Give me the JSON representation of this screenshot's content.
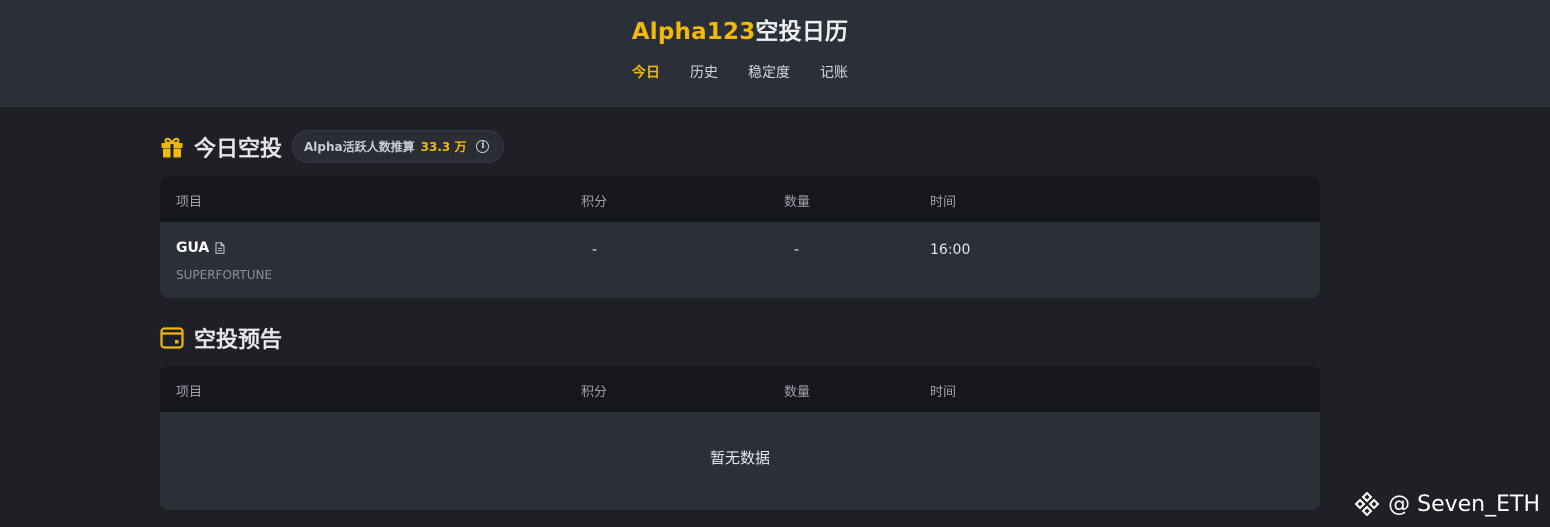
{
  "header": {
    "title_accent": "Alpha123",
    "title_rest": "空投日历",
    "nav": [
      {
        "label": "今日",
        "active": true
      },
      {
        "label": "历史",
        "active": false
      },
      {
        "label": "稳定度",
        "active": false
      },
      {
        "label": "记账",
        "active": false
      }
    ]
  },
  "today": {
    "icon": "gift-icon",
    "title": "今日空投",
    "active_users": {
      "label": "Alpha活跃人数推算",
      "value": "33.3 万",
      "info_icon": "info-icon"
    },
    "columns": [
      "项目",
      "积分",
      "数量",
      "时间"
    ],
    "rows": [
      {
        "token": "GUA",
        "project": "SUPERFORTUNE",
        "points": "-",
        "quantity": "-",
        "time": "16:00"
      }
    ]
  },
  "upcoming": {
    "icon": "calendar-icon",
    "title": "空投预告",
    "columns": [
      "项目",
      "积分",
      "数量",
      "时间"
    ],
    "empty_text": "暂无数据"
  },
  "watermark": {
    "text": "@ Seven_ETH",
    "icon": "binance-square-icon"
  },
  "colors": {
    "accent": "#f0b90b",
    "page_bg": "#1f2026",
    "header_bg": "#2b2f38",
    "table_header_bg": "#16171b",
    "row_bg": "#2b2f38"
  }
}
